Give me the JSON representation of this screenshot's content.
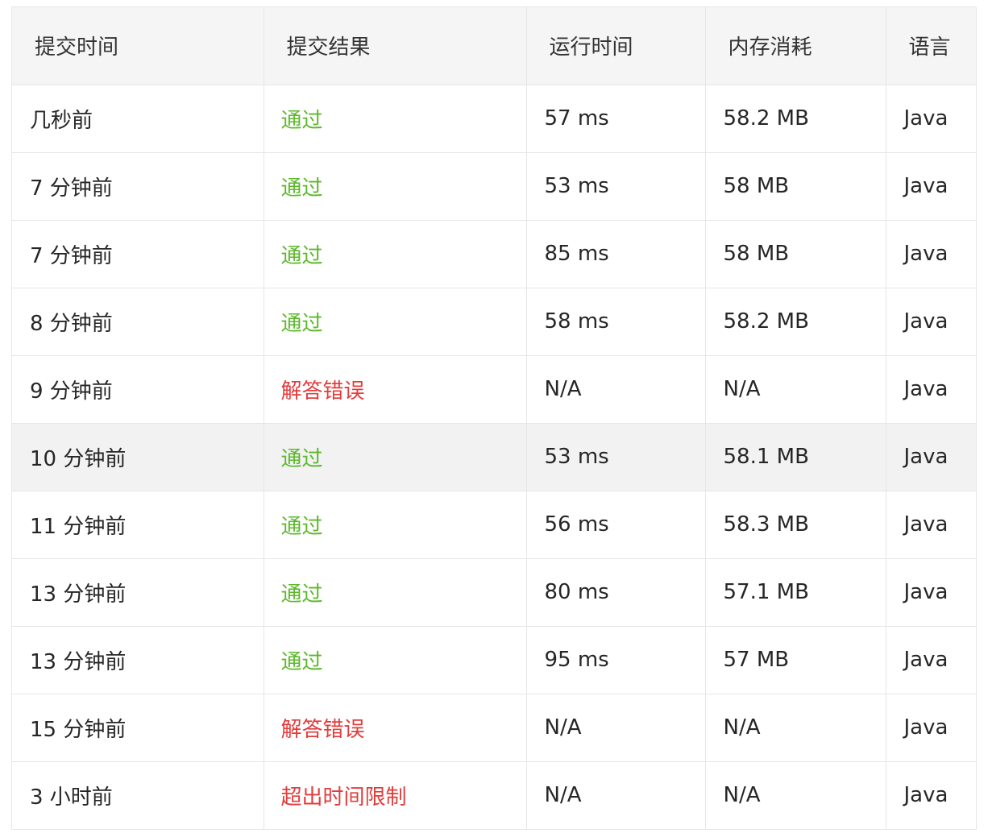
{
  "table": {
    "headers": [
      "提交时间",
      "提交结果",
      "运行时间",
      "内存消耗",
      "语言"
    ],
    "rows": [
      {
        "time": "几秒前",
        "result": "通过",
        "status": "ok",
        "runtime": "57 ms",
        "memory": "58.2 MB",
        "language": "Java"
      },
      {
        "time": "7 分钟前",
        "result": "通过",
        "status": "ok",
        "runtime": "53 ms",
        "memory": "58 MB",
        "language": "Java"
      },
      {
        "time": "7 分钟前",
        "result": "通过",
        "status": "ok",
        "runtime": "85 ms",
        "memory": "58 MB",
        "language": "Java"
      },
      {
        "time": "8 分钟前",
        "result": "通过",
        "status": "ok",
        "runtime": "58 ms",
        "memory": "58.2 MB",
        "language": "Java"
      },
      {
        "time": "9 分钟前",
        "result": "解答错误",
        "status": "bad",
        "runtime": "N/A",
        "memory": "N/A",
        "language": "Java"
      },
      {
        "time": "10 分钟前",
        "result": "通过",
        "status": "ok",
        "runtime": "53 ms",
        "memory": "58.1 MB",
        "language": "Java",
        "highlighted": true
      },
      {
        "time": "11 分钟前",
        "result": "通过",
        "status": "ok",
        "runtime": "56 ms",
        "memory": "58.3 MB",
        "language": "Java"
      },
      {
        "time": "13 分钟前",
        "result": "通过",
        "status": "ok",
        "runtime": "80 ms",
        "memory": "57.1 MB",
        "language": "Java"
      },
      {
        "time": "13 分钟前",
        "result": "通过",
        "status": "ok",
        "runtime": "95 ms",
        "memory": "57 MB",
        "language": "Java"
      },
      {
        "time": "15 分钟前",
        "result": "解答错误",
        "status": "bad",
        "runtime": "N/A",
        "memory": "N/A",
        "language": "Java"
      },
      {
        "time": "3 小时前",
        "result": "超出时间限制",
        "status": "bad",
        "runtime": "N/A",
        "memory": "N/A",
        "language": "Java"
      }
    ]
  },
  "colors": {
    "accepted": "#5cb82b",
    "error": "#e23c3c",
    "header_bg": "#f5f5f5",
    "highlight_bg": "#f2f2f2",
    "border": "#e6e6e6"
  }
}
